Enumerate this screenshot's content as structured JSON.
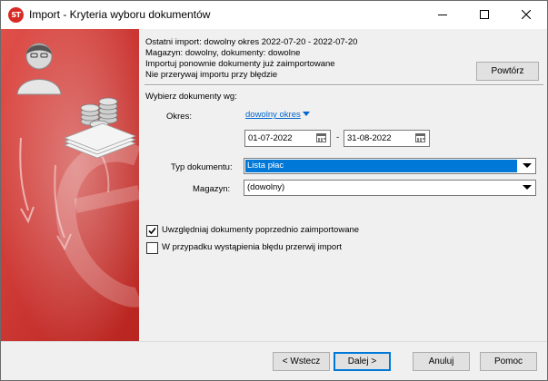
{
  "window": {
    "title": "Import - Kryteria wyboru dokumentów",
    "app_icon_text": "ST",
    "controls": [
      "minimize-icon",
      "maximize-icon",
      "close-icon"
    ]
  },
  "info": {
    "last_import": "Ostatni import: dowolny okres 2022-07-20 - 2022-07-20",
    "store_docs": "Magazyn: dowolny, dokumenty: dowolne",
    "reimport": "Importuj ponownie dokumenty już zaimportowane",
    "no_interrupt": "Nie przerywaj importu przy błędzie",
    "repeat_button": "Powtórz"
  },
  "criteria": {
    "header": "Wybierz dokumenty wg:",
    "period_label": "Okres:",
    "period_link": "dowolny okres",
    "date_from": "01-07-2022",
    "date_separator": "-",
    "date_to": "31-08-2022",
    "doc_type_label": "Typ dokumentu:",
    "doc_type_value": "Lista płac",
    "store_label": "Magazyn:",
    "store_value": "(dowolny)"
  },
  "options": {
    "include_imported": {
      "label": "Uwzględniaj dokumenty poprzednio zaimportowane",
      "checked": true
    },
    "stop_on_error": {
      "label": "W przypadku wystąpienia błędu przerwij import",
      "checked": false
    }
  },
  "footer": {
    "back": "< Wstecz",
    "next": "Dalej >",
    "cancel": "Anuluj",
    "help": "Pomoc"
  },
  "colors": {
    "accent": "#0078d7",
    "side_panel_red": "#c8322f",
    "link": "#0066cc"
  }
}
